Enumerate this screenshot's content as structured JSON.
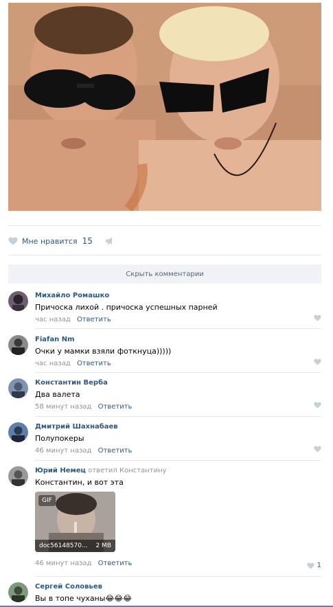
{
  "post": {
    "likes_label": "Мне нравится",
    "likes_count": "15"
  },
  "hide_comments_label": "Скрыть комментарии",
  "comments": [
    {
      "author": "Михайло Ромашко",
      "reply_to": "",
      "text": "Причоска лихой . причоска успешных парней",
      "time": "час назад",
      "reply_label": "Ответить",
      "likes": ""
    },
    {
      "author": "Fiafan Nm",
      "reply_to": "",
      "text": "Очки у мамки взяли фоткнуца)))))",
      "time": "час назад",
      "reply_label": "Ответить",
      "likes": ""
    },
    {
      "author": "Константин Верба",
      "reply_to": "",
      "text": "Два валета",
      "time": "58 минут назад",
      "reply_label": "Ответить",
      "likes": ""
    },
    {
      "author": "Дмитрий Шахнабаев",
      "reply_to": "",
      "text": "Полупокеры",
      "time": "46 минут назад",
      "reply_label": "Ответить",
      "likes": ""
    },
    {
      "author": "Юрий Немец",
      "reply_to": "ответил Константину",
      "text": "Константин, и вот эта",
      "time": "46 минут назад",
      "reply_label": "Ответить",
      "likes": "1",
      "attachment": {
        "badge": "GIF",
        "name": "doc56148570...",
        "size": "2 MB"
      }
    },
    {
      "author": "Сергей Соловьев",
      "reply_to": "",
      "text": "Вы в топе чуханы😂😂😂",
      "time": "",
      "reply_label": "",
      "likes": ""
    }
  ],
  "icons": {
    "like": "heart-icon",
    "share": "megaphone-icon"
  },
  "colors": {
    "link": "#2a5885",
    "meta": "#939393",
    "button_bg": "#f0f2f5"
  }
}
